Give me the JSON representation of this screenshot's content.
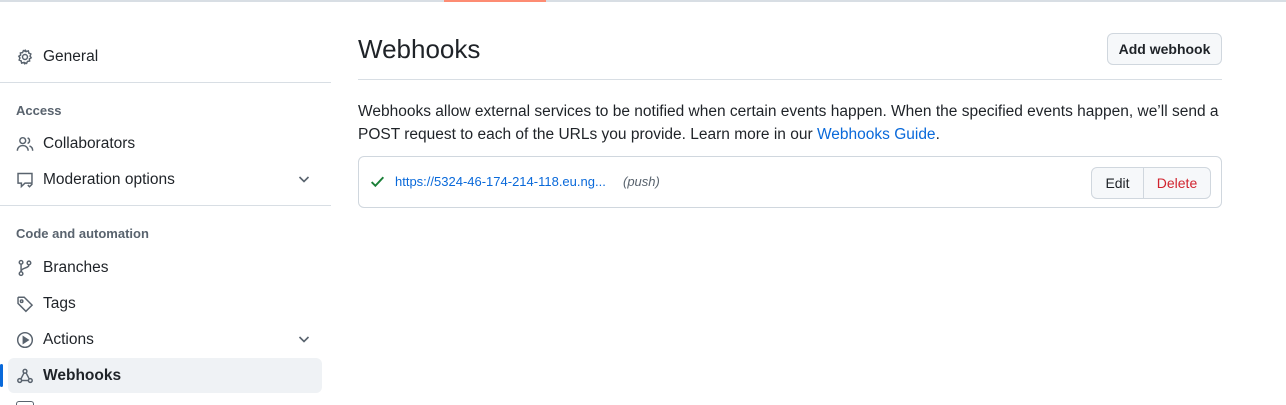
{
  "sidebar": {
    "general_label": "General",
    "access_heading": "Access",
    "collaborators_label": "Collaborators",
    "moderation_label": "Moderation options",
    "code_heading": "Code and automation",
    "branches_label": "Branches",
    "tags_label": "Tags",
    "actions_label": "Actions",
    "webhooks_label": "Webhooks"
  },
  "main": {
    "title": "Webhooks",
    "add_button": "Add webhook",
    "description_text": "Webhooks allow external services to be notified when certain events happen. When the specified events happen, we’ll send a POST request to each of the URLs you provide. Learn more in our ",
    "description_link": "Webhooks Guide",
    "description_end": ".",
    "webhook": {
      "url": "https://5324-46-174-214-118.eu.ng...",
      "events": "(push)",
      "edit_label": "Edit",
      "delete_label": "Delete"
    }
  },
  "colors": {
    "accent": "#0969da",
    "tab_underline": "#fd8c73",
    "success": "#1a7f37",
    "danger": "#d1242f"
  },
  "icons": [
    "gear-icon",
    "people-icon",
    "report-icon",
    "chevron-down-icon",
    "branch-icon",
    "tag-icon",
    "play-icon",
    "webhook-icon",
    "check-icon"
  ]
}
